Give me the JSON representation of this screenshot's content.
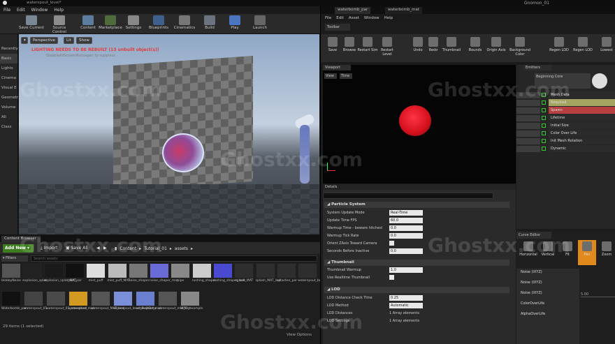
{
  "main": {
    "title": "waterspout_level*",
    "menu": [
      "File",
      "Edit",
      "Window",
      "Help"
    ],
    "toolbar": [
      "Save Current",
      "Source Control",
      "Content",
      "Marketplace",
      "Settings",
      "Blueprints",
      "Cinematics",
      "Build",
      "Play",
      "Launch"
    ],
    "left_tabs": [
      "Recently",
      "Basic",
      "Lights",
      "Cinema",
      "Visual E",
      "Geometr",
      "Volume",
      "All Class"
    ],
    "viewport": {
      "perspective": "Perspective",
      "lit": "Lit",
      "show": "Show",
      "warning": "LIGHTING NEEDS TO BE REBUILT (13 unbuilt object(s))",
      "warning_sub": "'DisableAllScreenMessages' to suppress"
    }
  },
  "content_browser": {
    "tab": "Content Browser",
    "add_new": "Add New",
    "import": "Import",
    "save_all": "Save All",
    "path": [
      "Content",
      "Tutorial_01",
      "assets"
    ],
    "filters": "Filters",
    "search_placeholder": "Search assets",
    "row1": [
      "blobbyNoise",
      "explosion_splat",
      "explosion_splat_MAT",
      "mist_par",
      "mist_puff",
      "mist_puff_MAT",
      "noise_shaper",
      "noise_shaper_mat",
      "pipe",
      "rushing_shaper",
      "rushing_shaper_mat",
      "splash_MAT",
      "splash_MAT_inst",
      "splashes_par",
      "waterspout_beam"
    ],
    "row2": [
      "Waterbomb_par",
      "waterspout_01",
      "waterspout_01_smoothed",
      "waterspout_mat",
      "waterspout_MAT_inst",
      "waterspout_level_BuiltData",
      "waterspout_mat",
      "waterspout_mat_inst",
      "WPO_example"
    ],
    "status": "29 items (1 selected)",
    "view_options": "View Options"
  },
  "cascade": {
    "tabs": [
      "waterbomb_par",
      "waterbomb_mat"
    ],
    "menu": [
      "File",
      "Edit",
      "Asset",
      "Window",
      "Help"
    ],
    "toolbar_label": "Toolbar",
    "toolbar": [
      "Save",
      "Browse",
      "Restart Sim",
      "Restart Level",
      "Undo",
      "Redo",
      "Thumbnail",
      "Bounds",
      "Origin Axis",
      "Background Color",
      "Regen LOD",
      "Regen LOD",
      "Lowest"
    ],
    "viewport_tab": "Viewport",
    "view": "View",
    "time": "Time",
    "details_tab": "Details",
    "sections": {
      "particle_system": "Particle System",
      "thumbnail": "Thumbnail",
      "lod": "LOD"
    },
    "props": [
      {
        "label": "System Update Mode",
        "value": "Real-Time"
      },
      {
        "label": "Update Time FPS",
        "value": "60.0"
      },
      {
        "label": "Warmup Time - beware hitches!",
        "value": "0.0"
      },
      {
        "label": "Warmup Tick Rate",
        "value": "0.0"
      },
      {
        "label": "Orient ZAxis Toward Camera",
        "value": ""
      },
      {
        "label": "Seconds Before Inactive",
        "value": "0.0"
      }
    ],
    "thumb_props": [
      {
        "label": "Thumbnail Warmup",
        "value": "1.0"
      },
      {
        "label": "Use Realtime Thumbnail",
        "value": ""
      }
    ],
    "lod_props": [
      {
        "label": "LOD Distance Check Time",
        "value": "0.25"
      },
      {
        "label": "LOD Method",
        "value": "Automatic"
      },
      {
        "label": "LOD Distances",
        "value": "1 Array elements"
      },
      {
        "label": "LOD Settings",
        "value": "1 Array elements"
      }
    ],
    "emitters_tab": "Emitters",
    "emitter_name": "Beginning Core",
    "modules": [
      "Mesh Data",
      "Required",
      "Spawn",
      "Lifetime",
      "Initial Size",
      "Color Over Life",
      "Init Mesh Rotation",
      "Dynamic"
    ],
    "curve_tab": "Curve Editor",
    "curve_tools": [
      "Horizontal",
      "Vertical",
      "Fit",
      "Pan",
      "Zoom"
    ],
    "curve_items": [
      "Noise (IXYZ)",
      "Noise (IXYZ)",
      "Noise (IXYZ)",
      "ColorOverLife",
      "AlphaOverLife"
    ],
    "curve_value": "5.00"
  },
  "watermark": "Ghostxx.com",
  "window_title_right": "Gnomon_01"
}
